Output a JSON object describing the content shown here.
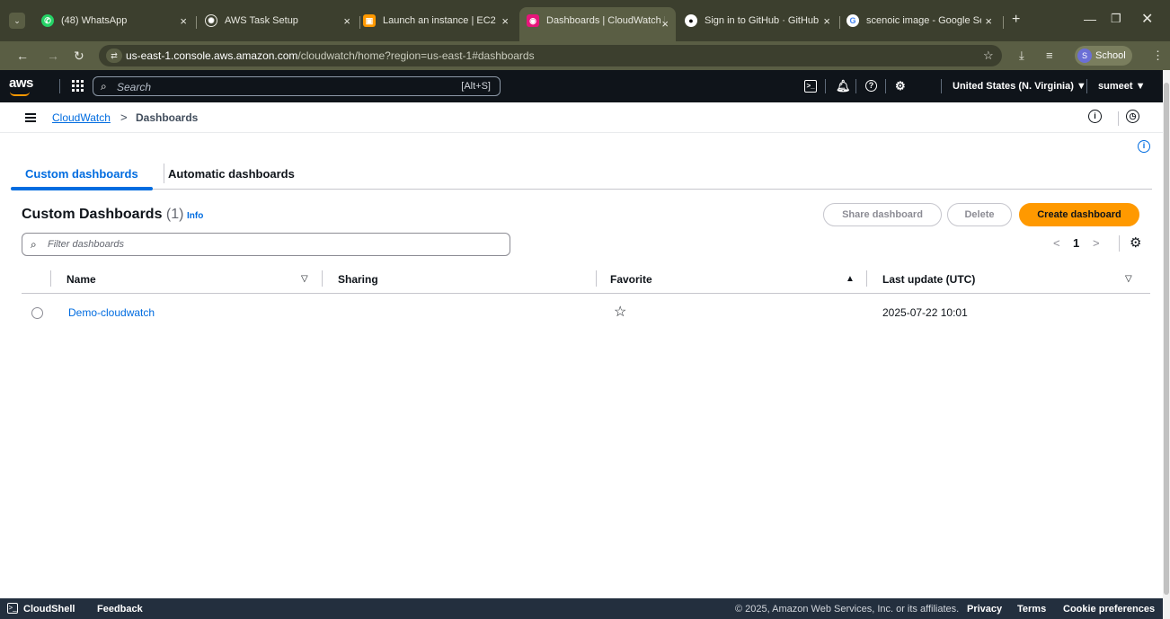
{
  "browser": {
    "tabs": [
      {
        "title": "(48) WhatsApp",
        "icon": "whatsapp-icon",
        "color": "#25d366"
      },
      {
        "title": "AWS Task Setup",
        "icon": "openai-icon",
        "color": "#e8e8e0"
      },
      {
        "title": "Launch an instance | EC2 |",
        "icon": "ec2-icon",
        "color": "#ff9900"
      },
      {
        "title": "Dashboards | CloudWatch |",
        "icon": "cloudwatch-icon",
        "color": "#e7157b"
      },
      {
        "title": "Sign in to GitHub · GitHub",
        "icon": "github-icon",
        "color": "#ffffff"
      },
      {
        "title": "scenoic image - Google Se",
        "icon": "google-icon",
        "color": "#4285f4"
      }
    ],
    "active_tab": 3,
    "new_tab": "+",
    "url_host": "us-east-1.console.aws.amazon.com",
    "url_path": "/cloudwatch/home?region=us-east-1#dashboards",
    "profile_initial": "S",
    "profile_label": "School"
  },
  "aws_nav": {
    "logo": "aws",
    "search_placeholder": "Search",
    "search_shortcut": "[Alt+S]",
    "region": "United States (N. Virginia) ▼",
    "user": "sumeet ▼"
  },
  "breadcrumb": {
    "service": "CloudWatch",
    "separator": ">",
    "current": "Dashboards"
  },
  "tabs": {
    "custom": "Custom dashboards",
    "automatic": "Automatic dashboards"
  },
  "header": {
    "title": "Custom Dashboards",
    "count": "(1)",
    "info": "Info"
  },
  "actions": {
    "share": "Share dashboard",
    "delete": "Delete",
    "create": "Create dashboard"
  },
  "filter": {
    "placeholder": "Filter dashboards"
  },
  "pagination": {
    "prev": "<",
    "page": "1",
    "next": ">"
  },
  "table": {
    "columns": {
      "name": "Name",
      "sharing": "Sharing",
      "favorite": "Favorite",
      "last_update": "Last update (UTC)"
    },
    "rows": [
      {
        "name": "Demo-cloudwatch",
        "sharing": "",
        "favorite": "☆",
        "last_update": "2025-07-22 10:01"
      }
    ]
  },
  "footer": {
    "cloudshell": "CloudShell",
    "feedback": "Feedback",
    "copyright": "© 2025, Amazon Web Services, Inc. or its affiliates.",
    "privacy": "Privacy",
    "terms": "Terms",
    "cookies": "Cookie preferences"
  },
  "colors": {
    "link": "#006ce0",
    "primary_button": "#ff9900",
    "aws_nav_bg": "#0f141a",
    "footer_bg": "#232f3e"
  }
}
